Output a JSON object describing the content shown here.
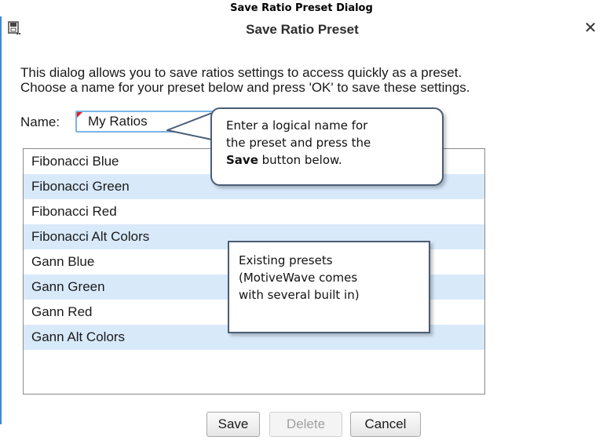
{
  "caption": "Save Ratio Preset Dialog",
  "dialog": {
    "title": "Save Ratio Preset",
    "title_icon": "save-disk-icon",
    "close_label": "✕",
    "description_line1": "This dialog allows you to save ratios settings to access quickly as a preset.",
    "description_line2": "Choose a name for your preset below and press 'OK' to save these settings.",
    "name_label": "Name:",
    "name_value": "My Ratios",
    "presets": [
      "Fibonacci Blue",
      "Fibonacci Green",
      "Fibonacci Red",
      "Fibonacci Alt Colors",
      "Gann Blue",
      "Gann Green",
      "Gann Red",
      "Gann Alt Colors"
    ],
    "buttons": {
      "save": "Save",
      "delete": "Delete",
      "cancel": "Cancel"
    }
  },
  "callouts": {
    "name_hint_line1": "Enter a logical name for",
    "name_hint_line2": "the preset and press the",
    "name_hint_bold": "Save",
    "name_hint_rest": " button below.",
    "presets_hint_line1": "Existing presets",
    "presets_hint_line2": "(MotiveWave comes",
    "presets_hint_line3": "with several built in)"
  },
  "colors": {
    "accent": "#3c8ad8",
    "list_alt_row": "#d8e9fa",
    "callout_border": "#4a5d76"
  }
}
